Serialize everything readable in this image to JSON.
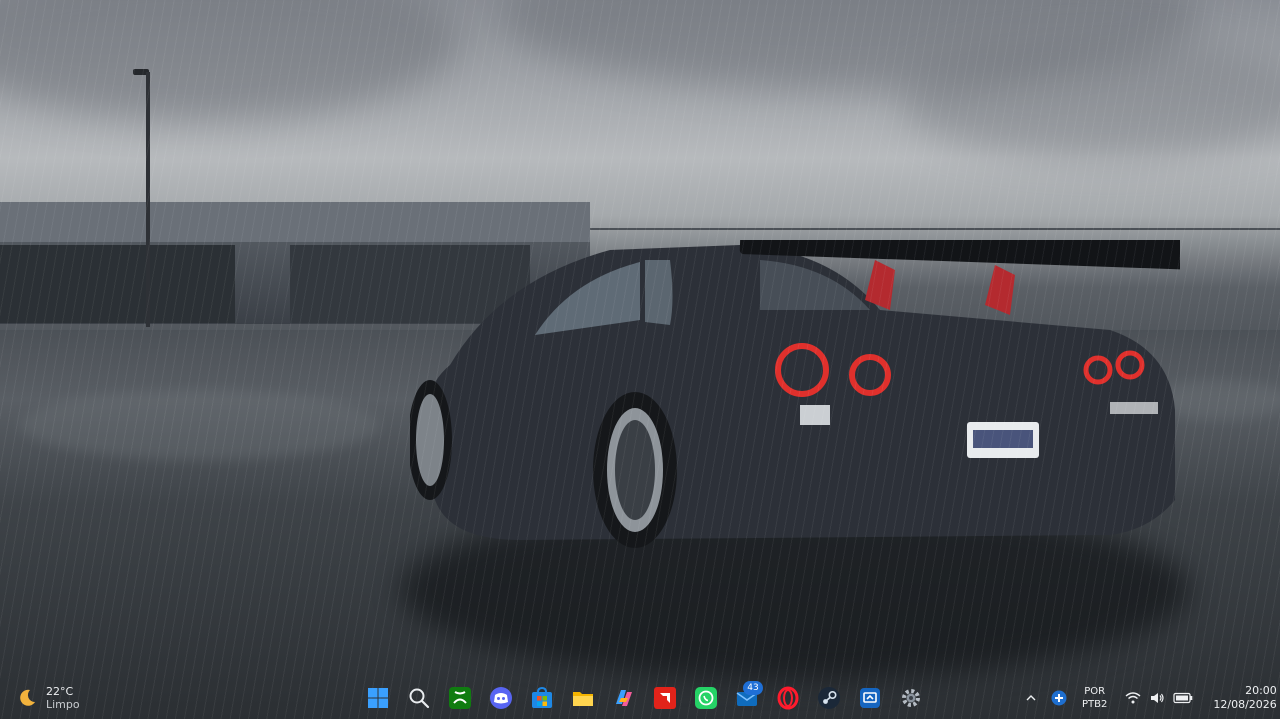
{
  "weather": {
    "temperature": "22°C",
    "condition": "Limpo",
    "icon": "moon-icon"
  },
  "taskbar": {
    "apps": [
      {
        "name": "start-button",
        "icon": "windows-logo-icon"
      },
      {
        "name": "search-button",
        "icon": "search-icon"
      },
      {
        "name": "xbox-app",
        "icon": "xbox-icon"
      },
      {
        "name": "discord-app",
        "icon": "discord-icon"
      },
      {
        "name": "microsoft-store-app",
        "icon": "store-icon"
      },
      {
        "name": "file-explorer-app",
        "icon": "folder-icon"
      },
      {
        "name": "copilot-app",
        "icon": "copilot-icon"
      },
      {
        "name": "amd-software-app",
        "icon": "amd-icon"
      },
      {
        "name": "whatsapp-app",
        "icon": "whatsapp-icon"
      },
      {
        "name": "mail-app",
        "icon": "mail-icon",
        "badge": "43"
      },
      {
        "name": "opera-app",
        "icon": "opera-icon"
      },
      {
        "name": "steam-app",
        "icon": "steam-icon"
      },
      {
        "name": "remote-app",
        "icon": "remote-icon"
      },
      {
        "name": "settings-app",
        "icon": "gear-icon"
      }
    ]
  },
  "tray": {
    "language_line1": "POR",
    "language_line2": "PTB2",
    "time": "20:00",
    "date": "12/08/2026"
  },
  "colors": {
    "accent": "#1f6fd6",
    "taillight": "#e0302c",
    "text": "#eef0f2"
  }
}
